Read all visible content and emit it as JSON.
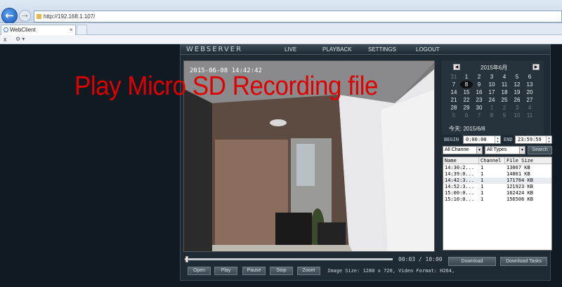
{
  "browser": {
    "address": "http://192.168.1.107/",
    "tab_label": "WebClient",
    "tab_close": "×",
    "cmd_close": "x"
  },
  "app": {
    "logo": "WEBSERVER",
    "nav": [
      "LIVE",
      "PLAYBACK",
      "SETTINGS",
      "LOGOUT"
    ]
  },
  "player": {
    "timestamp": "2015-06-08 14:42:42",
    "time_readout": "00:03 / 10:00",
    "progress": 0.005,
    "buttons": [
      "Open",
      "Play",
      "Pause",
      "Stop",
      "Zoom"
    ],
    "image_info": "Image Size: 1280 x 720, Video Format: H264,"
  },
  "calendar": {
    "title": "2015年6月",
    "prev": "◀",
    "next": "▶",
    "days": [
      {
        "d": "31",
        "m": true
      },
      {
        "d": "1"
      },
      {
        "d": "2"
      },
      {
        "d": "3"
      },
      {
        "d": "4"
      },
      {
        "d": "5"
      },
      {
        "d": "6"
      },
      {
        "d": "7"
      },
      {
        "d": "8",
        "sel": true
      },
      {
        "d": "9"
      },
      {
        "d": "10"
      },
      {
        "d": "11"
      },
      {
        "d": "12"
      },
      {
        "d": "13"
      },
      {
        "d": "14"
      },
      {
        "d": "15"
      },
      {
        "d": "16"
      },
      {
        "d": "17"
      },
      {
        "d": "18"
      },
      {
        "d": "19"
      },
      {
        "d": "20"
      },
      {
        "d": "21"
      },
      {
        "d": "22"
      },
      {
        "d": "23"
      },
      {
        "d": "24"
      },
      {
        "d": "25"
      },
      {
        "d": "26"
      },
      {
        "d": "27"
      },
      {
        "d": "28"
      },
      {
        "d": "29"
      },
      {
        "d": "30"
      },
      {
        "d": "1",
        "m": true
      },
      {
        "d": "2",
        "m": true
      },
      {
        "d": "3",
        "m": true
      },
      {
        "d": "4",
        "m": true
      },
      {
        "d": "5",
        "m": true
      },
      {
        "d": "6",
        "m": true
      },
      {
        "d": "7",
        "m": true
      },
      {
        "d": "8",
        "m": true
      },
      {
        "d": "9",
        "m": true
      },
      {
        "d": "10",
        "m": true
      },
      {
        "d": "11",
        "m": true
      }
    ],
    "today_label": "今天: 2015/6/8"
  },
  "search": {
    "begin_label": "BEGIN",
    "begin_value": "0:00:00",
    "end_label": "END",
    "end_value": "23:59:59",
    "channel_select": "All Channe",
    "type_select": "All Types",
    "search_label": "Search"
  },
  "file_list": {
    "headers": [
      "Name",
      "Channel",
      "File Size"
    ],
    "rows": [
      {
        "name": "14:30:2...",
        "channel": "1",
        "size": "13067 KB"
      },
      {
        "name": "14:39:0...",
        "channel": "1",
        "size": "14801 KB"
      },
      {
        "name": "14:42:3...",
        "channel": "1",
        "size": "171764 KB",
        "selected": true
      },
      {
        "name": "14:52:3...",
        "channel": "1",
        "size": "121923 KB"
      },
      {
        "name": "15:00:0...",
        "channel": "1",
        "size": "162424 KB"
      },
      {
        "name": "15:10:0...",
        "channel": "1",
        "size": "156506 KB"
      }
    ]
  },
  "downloads": {
    "download": "Download",
    "download_tasks": "Download Tasks"
  },
  "overlay": {
    "caption": "Play Micro SD Recording file"
  }
}
